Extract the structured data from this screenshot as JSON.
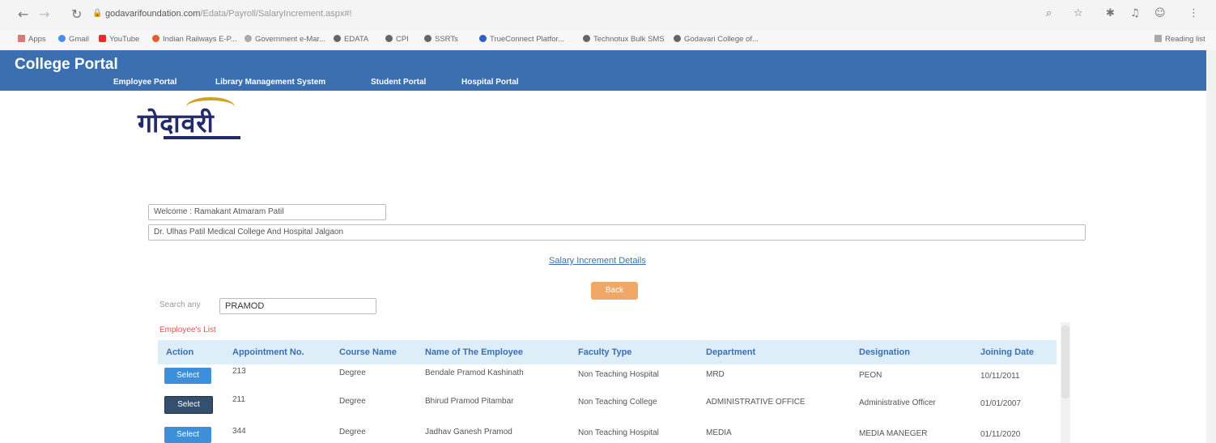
{
  "browser": {
    "url_domain": "godavarifoundation.com",
    "url_path": "/Edata/Payroll/SalaryIncrement.aspx#!",
    "bookmarks": [
      "Apps",
      "Gmail",
      "YouTube",
      "Indian Railways E-P...",
      "Government e-Mar...",
      "EDATA",
      "CPI",
      "SSRTs",
      "TrueConnect Platfor...",
      "Technotux Bulk SMS",
      "Godavari College of...",
      "Reading list"
    ]
  },
  "portal": {
    "title": "College Portal",
    "nav": [
      "Employee Portal",
      "Library Management System",
      "Student Portal",
      "Hospital Portal"
    ],
    "logo_text": "गोदावरी"
  },
  "welcome": "Welcome : Ramakant Atmaram Patil",
  "institution": "Dr. Ulhas Patil Medical College And Hospital Jalgaon",
  "salary_link": "Salary Increment Details",
  "back_label": "Back",
  "search": {
    "label": "Search any",
    "value": "PRAMOD"
  },
  "list_title": "Employee's List",
  "table": {
    "headers": [
      "Action",
      "Appointment No.",
      "Course Name",
      "Name of The Employee",
      "Faculty Type",
      "Department",
      "Designation",
      "Joining Date"
    ],
    "select_label": "Select",
    "rows": [
      {
        "appt": "213",
        "course": "Degree",
        "name": "Bendale Pramod Kashinath",
        "faculty": "Non Teaching Hospital",
        "dept": "MRD",
        "designation": "PEON",
        "joining": "10/11/2011"
      },
      {
        "appt": "211",
        "course": "Degree",
        "name": "Bhirud Pramod Pitambar",
        "faculty": "Non Teaching College",
        "dept": "ADMINISTRATIVE OFFICE",
        "designation": "Administrative Officer",
        "joining": "01/01/2007"
      },
      {
        "appt": "344",
        "course": "Degree",
        "name": "Jadhav Ganesh Pramod",
        "faculty": "Non Teaching Hospital",
        "dept": "MEDIA",
        "designation": "MEDIA MANEGER",
        "joining": "01/11/2020"
      }
    ]
  },
  "colors": {
    "header_bg": "#3b6fb0",
    "back_button": "#f0a867",
    "select_button": "#3d8fd9",
    "list_title": "#e05555"
  }
}
